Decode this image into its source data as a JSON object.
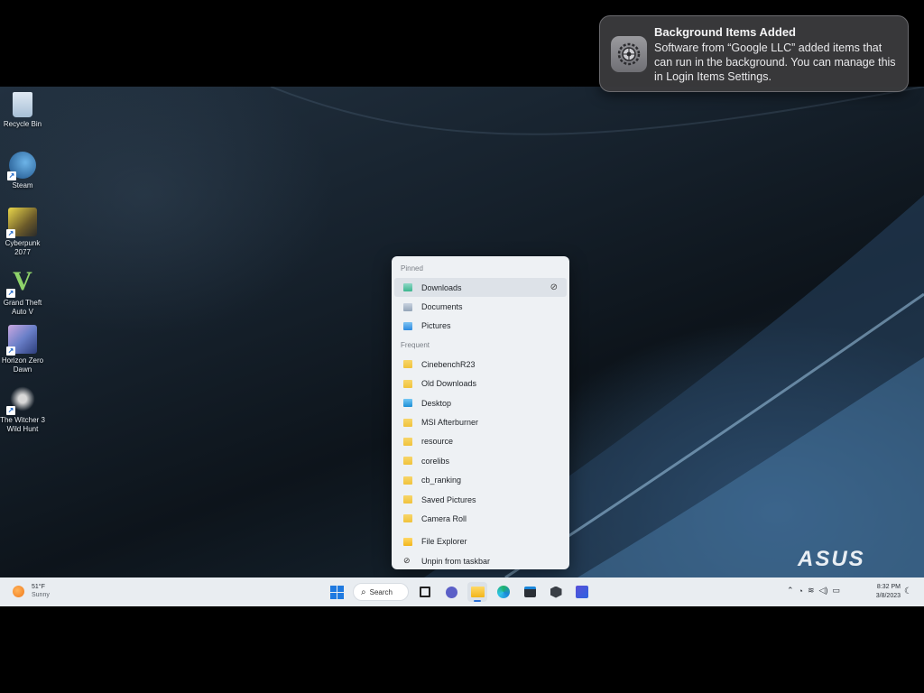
{
  "notification": {
    "title": "Background Items Added",
    "body": "Software from “Google LLC” added items that can run in the background. You can manage this in Login Items Settings.",
    "icon": "gear-settings-icon"
  },
  "desktop": {
    "icons": [
      {
        "label": "Recycle Bin",
        "icon": "recycle-bin-icon"
      },
      {
        "label": "Steam",
        "icon": "steam-icon"
      },
      {
        "label": "Cyberpunk 2077",
        "icon": "cyberpunk-icon"
      },
      {
        "label": "Grand Theft Auto V",
        "icon": "gta-v-icon"
      },
      {
        "label": "Horizon Zero Dawn",
        "icon": "horizon-icon"
      },
      {
        "label": "The Witcher 3 Wild Hunt",
        "icon": "witcher-icon"
      }
    ],
    "brand": "ASUS"
  },
  "jumplist": {
    "pinned_header": "Pinned",
    "pinned": [
      {
        "label": "Downloads",
        "icon": "download-folder-icon"
      },
      {
        "label": "Documents",
        "icon": "documents-folder-icon"
      },
      {
        "label": "Pictures",
        "icon": "pictures-folder-icon"
      }
    ],
    "frequent_header": "Frequent",
    "frequent": [
      {
        "label": "CinebenchR23"
      },
      {
        "label": "Old Downloads"
      },
      {
        "label": "Desktop"
      },
      {
        "label": "MSI Afterburner"
      },
      {
        "label": "resource"
      },
      {
        "label": "corelibs"
      },
      {
        "label": "cb_ranking"
      },
      {
        "label": "Saved Pictures"
      },
      {
        "label": "Camera Roll"
      }
    ],
    "actions": [
      {
        "label": "File Explorer",
        "icon": "file-explorer-icon"
      },
      {
        "label": "Unpin from taskbar",
        "icon": "unpin-icon"
      }
    ]
  },
  "taskbar": {
    "weather": {
      "temp": "51°F",
      "condition": "Sunny"
    },
    "search_label": "Search",
    "apps": [
      "task-view",
      "chat",
      "file-explorer",
      "edge",
      "store",
      "app-hexagon",
      "app-purple"
    ],
    "clock": {
      "time": "8:32 PM",
      "date": "3/8/2023"
    }
  },
  "colors": {
    "accent": "#1f7ae0",
    "toast_bg": "#3a3a3c",
    "taskbar_bg": "#e9edf1"
  }
}
